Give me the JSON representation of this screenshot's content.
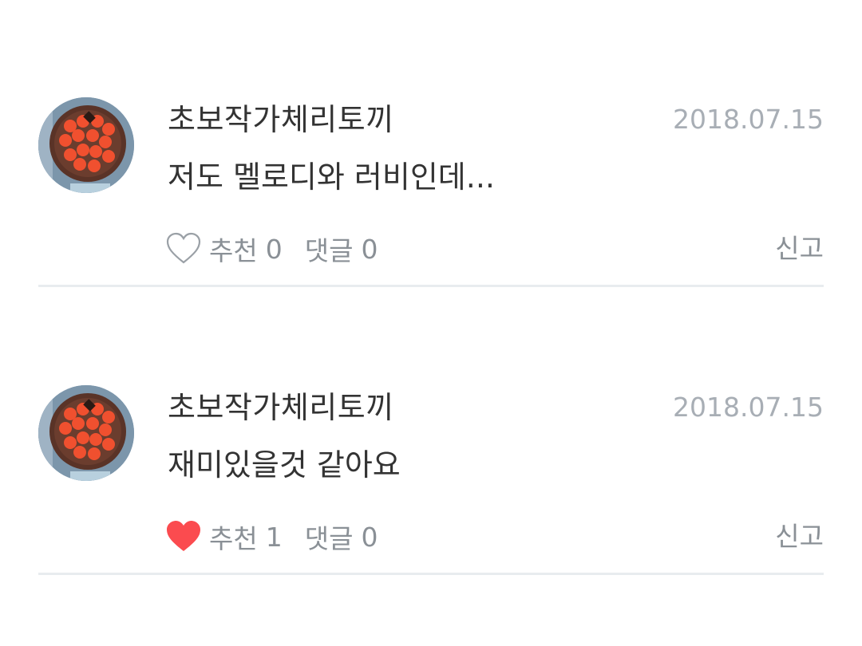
{
  "comments": [
    {
      "author": "초보작가체리토끼",
      "date": "2018.07.15",
      "text": "저도 멜로디와 러비인데...",
      "like_label": "추천",
      "like_count": "0",
      "liked": false,
      "reply_label": "댓글",
      "reply_count": "0",
      "report_label": "신고",
      "avatar_icon": "strawberry-tart-avatar"
    },
    {
      "author": "초보작가체리토끼",
      "date": "2018.07.15",
      "text": "재미있을것 같아요",
      "like_label": "추천",
      "like_count": "1",
      "liked": true,
      "reply_label": "댓글",
      "reply_count": "0",
      "report_label": "신고",
      "avatar_icon": "strawberry-tart-avatar"
    }
  ],
  "colors": {
    "liked_heart": "#fb4b4f",
    "unliked_heart_stroke": "#9aa0a6",
    "meta_text": "#8a9096",
    "date_text": "#a8aeb5",
    "divider": "#e8ecef"
  }
}
